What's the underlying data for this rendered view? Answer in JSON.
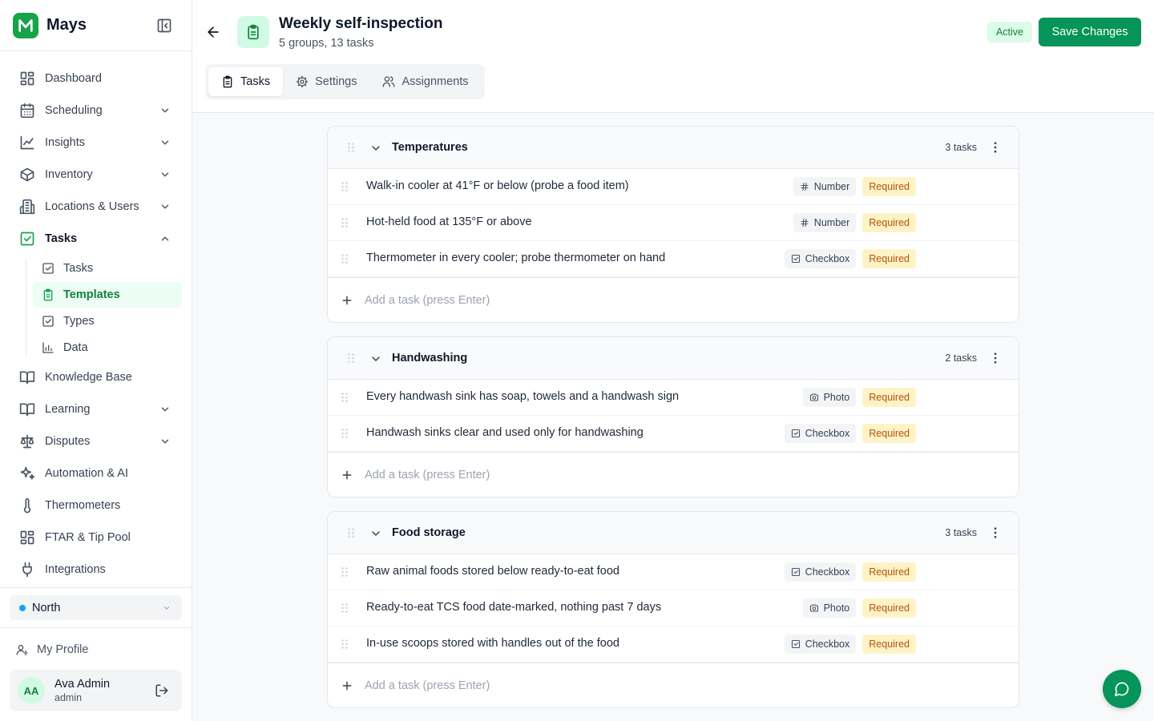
{
  "app": {
    "name": "Mays",
    "brand_color": "#16a34a"
  },
  "sidebar": {
    "items": [
      {
        "label": "Dashboard",
        "icon": "dashboard-icon",
        "chevron": ""
      },
      {
        "label": "Scheduling",
        "icon": "calendar-icon",
        "chevron": "down"
      },
      {
        "label": "Insights",
        "icon": "line-chart-icon",
        "chevron": "down"
      },
      {
        "label": "Inventory",
        "icon": "box-icon",
        "chevron": "down"
      },
      {
        "label": "Locations & Users",
        "icon": "building-icon",
        "chevron": "down"
      },
      {
        "label": "Tasks",
        "icon": "checkbox-icon",
        "chevron": "up",
        "active": true
      },
      {
        "label": "Knowledge Base",
        "icon": "book-icon",
        "chevron": ""
      },
      {
        "label": "Learning",
        "icon": "book-icon",
        "chevron": "down"
      },
      {
        "label": "Disputes",
        "icon": "scale-icon",
        "chevron": "down"
      },
      {
        "label": "Automation & AI",
        "icon": "sparkles-icon",
        "chevron": ""
      },
      {
        "label": "Thermometers",
        "icon": "thermometer-icon",
        "chevron": ""
      },
      {
        "label": "FTAR & Tip Pool",
        "icon": "grid-icon",
        "chevron": ""
      },
      {
        "label": "Integrations",
        "icon": "plug-icon",
        "chevron": ""
      }
    ],
    "task_subitems": [
      {
        "label": "Tasks",
        "icon": "checkbox-icon"
      },
      {
        "label": "Templates",
        "icon": "clipboard-icon",
        "active": true
      },
      {
        "label": "Types",
        "icon": "checkbox-icon"
      },
      {
        "label": "Data",
        "icon": "bar-chart-icon"
      }
    ],
    "location": "North",
    "profile_link": "My Profile",
    "user": {
      "initials": "AA",
      "name": "Ava Admin",
      "role": "admin"
    }
  },
  "header": {
    "title": "Weekly self-inspection",
    "subtitle": "5 groups, 13 tasks",
    "status": "Active",
    "save_label": "Save Changes",
    "tabs": [
      {
        "label": "Tasks",
        "icon": "clipboard-icon",
        "active": true
      },
      {
        "label": "Settings",
        "icon": "gear-icon"
      },
      {
        "label": "Assignments",
        "icon": "users-icon"
      }
    ]
  },
  "groups": [
    {
      "name": "Temperatures",
      "count": "3 tasks",
      "tasks": [
        {
          "name": "Walk-in cooler at 41°F or below (probe a food item)",
          "type": "Number",
          "type_icon": "hash-icon",
          "required": "Required"
        },
        {
          "name": "Hot-held food at 135°F or above",
          "type": "Number",
          "type_icon": "hash-icon",
          "required": "Required"
        },
        {
          "name": "Thermometer in every cooler; probe thermometer on hand",
          "type": "Checkbox",
          "type_icon": "checkbox-icon",
          "required": "Required"
        }
      ],
      "add_placeholder": "Add a task (press Enter)"
    },
    {
      "name": "Handwashing",
      "count": "2 tasks",
      "tasks": [
        {
          "name": "Every handwash sink has soap, towels and a handwash sign",
          "type": "Photo",
          "type_icon": "camera-icon",
          "required": "Required"
        },
        {
          "name": "Handwash sinks clear and used only for handwashing",
          "type": "Checkbox",
          "type_icon": "checkbox-icon",
          "required": "Required"
        }
      ],
      "add_placeholder": "Add a task (press Enter)"
    },
    {
      "name": "Food storage",
      "count": "3 tasks",
      "tasks": [
        {
          "name": "Raw animal foods stored below ready-to-eat food",
          "type": "Checkbox",
          "type_icon": "checkbox-icon",
          "required": "Required"
        },
        {
          "name": "Ready-to-eat TCS food date-marked, nothing past 7 days",
          "type": "Photo",
          "type_icon": "camera-icon",
          "required": "Required"
        },
        {
          "name": "In-use scoops stored with handles out of the food",
          "type": "Checkbox",
          "type_icon": "checkbox-icon",
          "required": "Required"
        }
      ],
      "add_placeholder": "Add a task (press Enter)"
    }
  ]
}
